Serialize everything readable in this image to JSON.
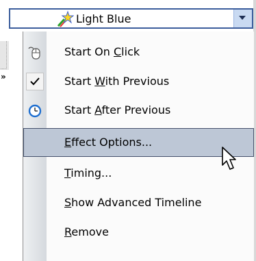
{
  "effect_combo": {
    "value": "Light Blue",
    "icon": "sparkle-star-icon"
  },
  "menu": {
    "items": [
      {
        "name": "start-on-click",
        "pre": "Start On ",
        "key": "C",
        "post": "lick",
        "icon": "mouse-icon",
        "checked": false,
        "selected": false
      },
      {
        "name": "start-with-previous",
        "pre": "Start ",
        "key": "W",
        "post": "ith Previous",
        "icon": "checkmark-icon",
        "checked": true,
        "selected": false
      },
      {
        "name": "start-after-previous",
        "pre": "Start ",
        "key": "A",
        "post": "fter Previous",
        "icon": "clock-icon",
        "checked": false,
        "selected": false
      },
      {
        "name": "effect-options",
        "pre": "",
        "key": "E",
        "post": "ffect Options...",
        "icon": "",
        "checked": false,
        "selected": true
      },
      {
        "name": "timing",
        "pre": "",
        "key": "T",
        "post": "iming...",
        "icon": "",
        "checked": false,
        "selected": false
      },
      {
        "name": "show-advanced-timeline",
        "pre": "",
        "key": "S",
        "post": "how Advanced Timeline",
        "icon": "",
        "checked": false,
        "selected": false
      },
      {
        "name": "remove",
        "pre": "",
        "key": "R",
        "post": "emove",
        "icon": "",
        "checked": false,
        "selected": false
      }
    ]
  },
  "colors": {
    "highlight": "#bdc7d6",
    "highlight_border": "#44506b",
    "combo_border": "#3b5d9c"
  }
}
